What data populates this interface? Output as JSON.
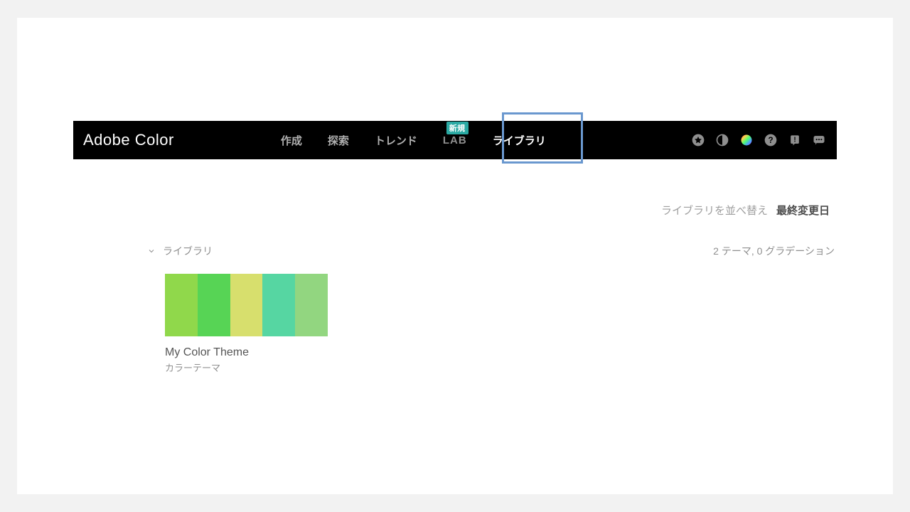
{
  "brand": "Adobe Color",
  "nav": {
    "create": "作成",
    "explore": "探索",
    "trends": "トレンド",
    "lab": "LAB",
    "lab_badge": "新規",
    "libraries": "ライブラリ"
  },
  "sort": {
    "label": "ライブラリを並べ替え",
    "value": "最終変更日"
  },
  "library": {
    "section_title": "ライブラリ",
    "count_text": "2 テーマ, 0 グラデーション"
  },
  "theme": {
    "title": "My Color Theme",
    "subtitle": "カラーテーマ",
    "colors": [
      "#90d84b",
      "#57d455",
      "#d7df6d",
      "#56d6a2",
      "#92d680"
    ]
  }
}
